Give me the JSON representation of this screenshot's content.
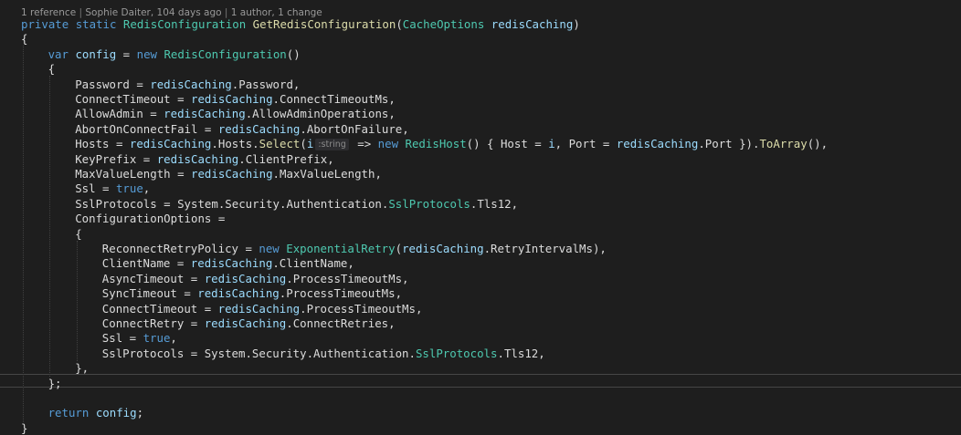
{
  "codelens": {
    "references": "1 reference",
    "author_time": "Sophie Daiter, 104 days ago",
    "changes": "1 author, 1 change",
    "separator": "|"
  },
  "code": {
    "lines": [
      {
        "indent": 0,
        "tokens": [
          [
            "kw",
            "private"
          ],
          [
            "pl",
            " "
          ],
          [
            "kw",
            "static"
          ],
          [
            "pl",
            " "
          ],
          [
            "ty",
            "RedisConfiguration"
          ],
          [
            "pl",
            " "
          ],
          [
            "me",
            "GetRedisConfiguration"
          ],
          [
            "pl",
            "("
          ],
          [
            "ty",
            "CacheOptions"
          ],
          [
            "pl",
            " "
          ],
          [
            "va",
            "redisCaching"
          ],
          [
            "pl",
            ")"
          ]
        ]
      },
      {
        "indent": 0,
        "tokens": [
          [
            "pl",
            "{"
          ]
        ]
      },
      {
        "indent": 4,
        "tokens": [
          [
            "kw",
            "var"
          ],
          [
            "pl",
            " "
          ],
          [
            "va",
            "config"
          ],
          [
            "pl",
            " = "
          ],
          [
            "kw",
            "new"
          ],
          [
            "pl",
            " "
          ],
          [
            "ty",
            "RedisConfiguration"
          ],
          [
            "pl",
            "()"
          ]
        ]
      },
      {
        "indent": 4,
        "tokens": [
          [
            "pl",
            "{"
          ]
        ]
      },
      {
        "indent": 8,
        "tokens": [
          [
            "pl",
            "Password = "
          ],
          [
            "va",
            "redisCaching"
          ],
          [
            "pl",
            ".Password,"
          ]
        ]
      },
      {
        "indent": 8,
        "tokens": [
          [
            "pl",
            "ConnectTimeout = "
          ],
          [
            "va",
            "redisCaching"
          ],
          [
            "pl",
            ".ConnectTimeoutMs,"
          ]
        ]
      },
      {
        "indent": 8,
        "tokens": [
          [
            "pl",
            "AllowAdmin = "
          ],
          [
            "va",
            "redisCaching"
          ],
          [
            "pl",
            ".AllowAdminOperations,"
          ]
        ]
      },
      {
        "indent": 8,
        "tokens": [
          [
            "pl",
            "AbortOnConnectFail = "
          ],
          [
            "va",
            "redisCaching"
          ],
          [
            "pl",
            ".AbortOnFailure,"
          ]
        ]
      },
      {
        "indent": 8,
        "tokens": [
          [
            "pl",
            "Hosts = "
          ],
          [
            "va",
            "redisCaching"
          ],
          [
            "pl",
            ".Hosts."
          ],
          [
            "me",
            "Select"
          ],
          [
            "pl",
            "("
          ],
          [
            "va",
            "i"
          ],
          [
            "hint",
            ":string"
          ],
          [
            "pl",
            " => "
          ],
          [
            "kw",
            "new"
          ],
          [
            "pl",
            " "
          ],
          [
            "ty",
            "RedisHost"
          ],
          [
            "pl",
            "() { Host = "
          ],
          [
            "va",
            "i"
          ],
          [
            "pl",
            ", Port = "
          ],
          [
            "va",
            "redisCaching"
          ],
          [
            "pl",
            ".Port })."
          ],
          [
            "me",
            "ToArray"
          ],
          [
            "pl",
            "(),"
          ]
        ]
      },
      {
        "indent": 8,
        "tokens": [
          [
            "pl",
            "KeyPrefix = "
          ],
          [
            "va",
            "redisCaching"
          ],
          [
            "pl",
            ".ClientPrefix,"
          ]
        ]
      },
      {
        "indent": 8,
        "tokens": [
          [
            "pl",
            "MaxValueLength = "
          ],
          [
            "va",
            "redisCaching"
          ],
          [
            "pl",
            ".MaxValueLength,"
          ]
        ]
      },
      {
        "indent": 8,
        "tokens": [
          [
            "pl",
            "Ssl = "
          ],
          [
            "kw",
            "true"
          ],
          [
            "pl",
            ","
          ]
        ]
      },
      {
        "indent": 8,
        "tokens": [
          [
            "pl",
            "SslProtocols = System.Security.Authentication."
          ],
          [
            "ty",
            "SslProtocols"
          ],
          [
            "pl",
            ".Tls12,"
          ]
        ]
      },
      {
        "indent": 8,
        "tokens": [
          [
            "pl",
            "ConfigurationOptions ="
          ]
        ]
      },
      {
        "indent": 8,
        "tokens": [
          [
            "pl",
            "{"
          ]
        ]
      },
      {
        "indent": 12,
        "tokens": [
          [
            "pl",
            "ReconnectRetryPolicy = "
          ],
          [
            "kw",
            "new"
          ],
          [
            "pl",
            " "
          ],
          [
            "ty",
            "ExponentialRetry"
          ],
          [
            "pl",
            "("
          ],
          [
            "va",
            "redisCaching"
          ],
          [
            "pl",
            ".RetryIntervalMs),"
          ]
        ]
      },
      {
        "indent": 12,
        "tokens": [
          [
            "pl",
            "ClientName = "
          ],
          [
            "va",
            "redisCaching"
          ],
          [
            "pl",
            ".ClientName,"
          ]
        ]
      },
      {
        "indent": 12,
        "tokens": [
          [
            "pl",
            "AsyncTimeout = "
          ],
          [
            "va",
            "redisCaching"
          ],
          [
            "pl",
            ".ProcessTimeoutMs,"
          ]
        ]
      },
      {
        "indent": 12,
        "tokens": [
          [
            "pl",
            "SyncTimeout = "
          ],
          [
            "va",
            "redisCaching"
          ],
          [
            "pl",
            ".ProcessTimeoutMs,"
          ]
        ]
      },
      {
        "indent": 12,
        "tokens": [
          [
            "pl",
            "ConnectTimeout = "
          ],
          [
            "va",
            "redisCaching"
          ],
          [
            "pl",
            ".ProcessTimeoutMs,"
          ]
        ]
      },
      {
        "indent": 12,
        "tokens": [
          [
            "pl",
            "ConnectRetry = "
          ],
          [
            "va",
            "redisCaching"
          ],
          [
            "pl",
            ".ConnectRetries,"
          ]
        ]
      },
      {
        "indent": 12,
        "tokens": [
          [
            "pl",
            "Ssl = "
          ],
          [
            "kw",
            "true"
          ],
          [
            "pl",
            ","
          ]
        ]
      },
      {
        "indent": 12,
        "tokens": [
          [
            "pl",
            "SslProtocols = System.Security.Authentication."
          ],
          [
            "ty",
            "SslProtocols"
          ],
          [
            "pl",
            ".Tls12,"
          ]
        ]
      },
      {
        "indent": 8,
        "tokens": [
          [
            "pl",
            "},"
          ]
        ]
      },
      {
        "indent": 4,
        "tokens": [
          [
            "pl",
            "};"
          ]
        ]
      },
      {
        "indent": 0,
        "tokens": []
      },
      {
        "indent": 4,
        "tokens": [
          [
            "kw",
            "return"
          ],
          [
            "pl",
            " "
          ],
          [
            "va",
            "config"
          ],
          [
            "pl",
            ";"
          ]
        ]
      },
      {
        "indent": 0,
        "tokens": [
          [
            "pl",
            "}"
          ]
        ]
      }
    ]
  }
}
